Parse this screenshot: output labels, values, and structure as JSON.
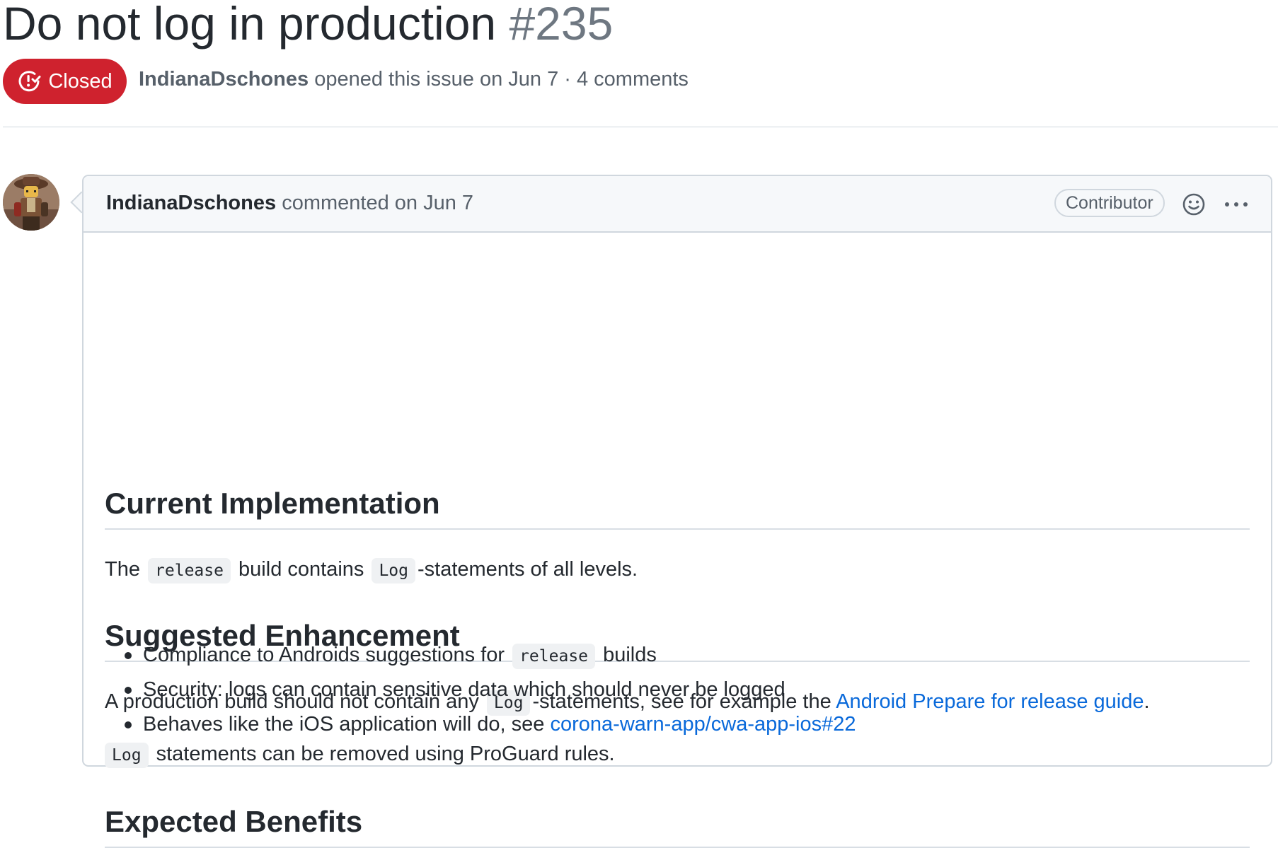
{
  "issue": {
    "title": "Do not log in production",
    "number": "#235",
    "state": "Closed",
    "state_color": "#cf222e",
    "author": "IndianaDschones",
    "meta_text": "opened this issue on Jun 7 · 4 comments"
  },
  "comment": {
    "author": "IndianaDschones",
    "action_text": "commented on Jun 7",
    "role": "Contributor",
    "sections": {
      "current": {
        "heading": "Current Implementation",
        "p1_a": "The",
        "p1_code1": "release",
        "p1_b": "build contains",
        "p1_code2": "Log",
        "p1_c": "-statements of all levels."
      },
      "suggested": {
        "heading": "Suggested Enhancement",
        "p1_a": "A production build should not contain any",
        "p1_code": "Log",
        "p1_b": "-statements, see for example the",
        "p1_link": "Android Prepare for release guide",
        "p1_c": ".",
        "p2_code": "Log",
        "p2_text": "statements can be removed using ProGuard rules."
      },
      "benefits": {
        "heading": "Expected Benefits",
        "item1_a": "Compliance to Androids suggestions for",
        "item1_code": "release",
        "item1_b": "builds",
        "item2": "Security: logs can contain sensitive data which should never be logged",
        "item3_a": "Behaves like the iOS application will do, see",
        "item3_link": "corona-warn-app/cwa-app-ios#22"
      }
    }
  },
  "icons": {
    "state": "issue-closed-icon",
    "reaction": "smiley-icon",
    "more": "kebab-horizontal-icon",
    "avatar": "user-avatar"
  },
  "colors": {
    "link": "#0969da",
    "closed_badge": "#cf222e",
    "border": "#d0d7de",
    "header_bg": "#f6f8fa"
  }
}
